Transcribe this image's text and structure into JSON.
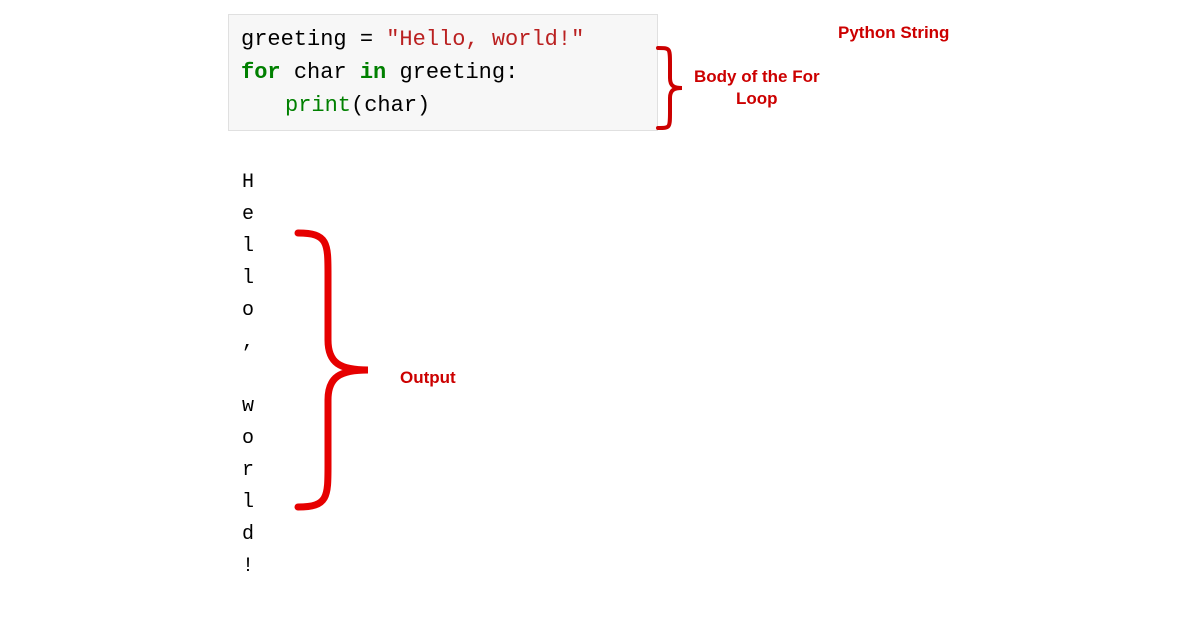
{
  "code": {
    "line1": {
      "var": "greeting",
      "equals": " = ",
      "string": "\"Hello, world!\""
    },
    "line2": {
      "for": "for",
      "sp1": " ",
      "char": "char",
      "sp2": " ",
      "in": "in",
      "sp3": " ",
      "greeting": "greeting",
      "colon": ":"
    },
    "line3": {
      "print": "print",
      "open": "(",
      "char": "char",
      "close": ")"
    }
  },
  "output": [
    "H",
    "e",
    "l",
    "l",
    "o",
    ",",
    " ",
    "w",
    "o",
    "r",
    "l",
    "d",
    "!"
  ],
  "annotations": {
    "python_string": "Python String",
    "body_line1": "Body of the For",
    "body_line2": "Loop",
    "output": "Output"
  }
}
